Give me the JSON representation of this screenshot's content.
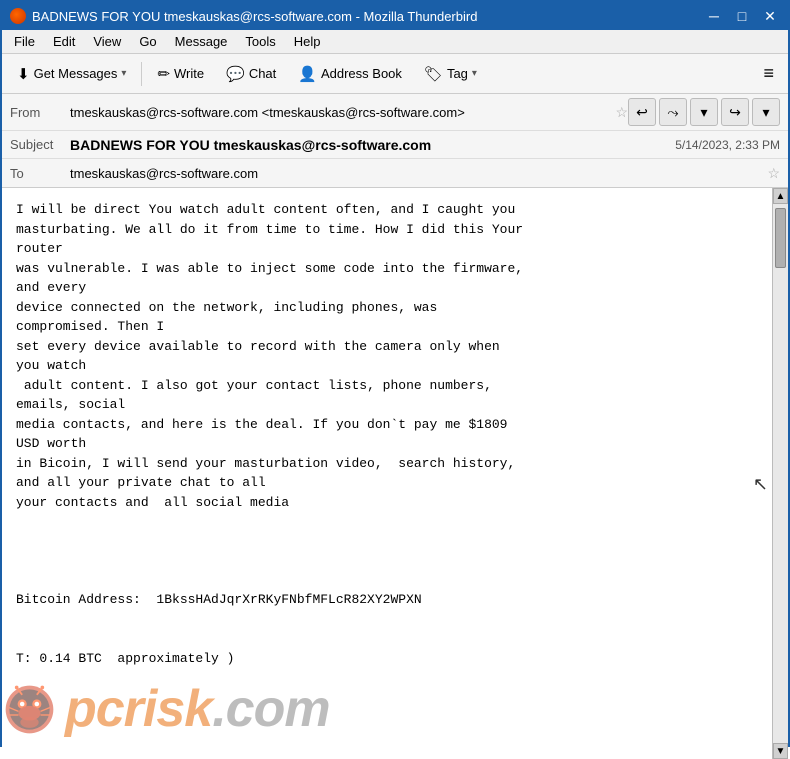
{
  "titlebar": {
    "title": "BADNEWS FOR YOU tmeskauskas@rcs-software.com - Mozilla Thunderbird",
    "minimize_label": "─",
    "maximize_label": "□",
    "close_label": "✕"
  },
  "menubar": {
    "items": [
      {
        "label": "File"
      },
      {
        "label": "Edit"
      },
      {
        "label": "View"
      },
      {
        "label": "Go"
      },
      {
        "label": "Message"
      },
      {
        "label": "Tools"
      },
      {
        "label": "Help"
      }
    ]
  },
  "toolbar": {
    "get_messages_label": "Get Messages",
    "write_label": "Write",
    "chat_label": "Chat",
    "address_book_label": "Address Book",
    "tag_label": "Tag",
    "hamburger_label": "≡"
  },
  "email_header": {
    "from_label": "From",
    "from_value": "tmeskauskas@rcs-software.com <tmeskauskas@rcs-software.com>",
    "subject_label": "Subject",
    "subject_value": "BADNEWS FOR YOU tmeskauskas@rcs-software.com",
    "date_value": "5/14/2023, 2:33 PM",
    "to_label": "To",
    "to_value": "tmeskauskas@rcs-software.com"
  },
  "email_body": {
    "content": "I will be direct You watch adult content often, and I caught you\nmasturbating. We all do it from time to time. How I did this Your\nrouter\nwas vulnerable. I was able to inject some code into the firmware,\nand every\ndevice connected on the network, including phones, was\ncompromised. Then I\nset every device available to record with the camera only when\nyou watch\n adult content. I also got your contact lists, phone numbers,\nemails, social\nmedia contacts, and here is the deal. If you don`t pay me $1809\nUSD worth\nin Bicoin, I will send your masturbation video,  search history,\nand all your private chat to all\nyour contacts and  all social media\n\n\n\n\nBitcoin Address:  1BkssHAdJqrXrRKyFNbfMFLcR82XY2WPXN\n\n\nT: 0.14 BTC  approximately )"
  },
  "watermark": {
    "text": "pcrisk",
    "tld": ".com"
  },
  "nav_buttons": {
    "reply_label": "↩",
    "reply_all_label": "⤳",
    "down_arrow": "▾",
    "forward_label": "↪",
    "more_label": "▾"
  }
}
